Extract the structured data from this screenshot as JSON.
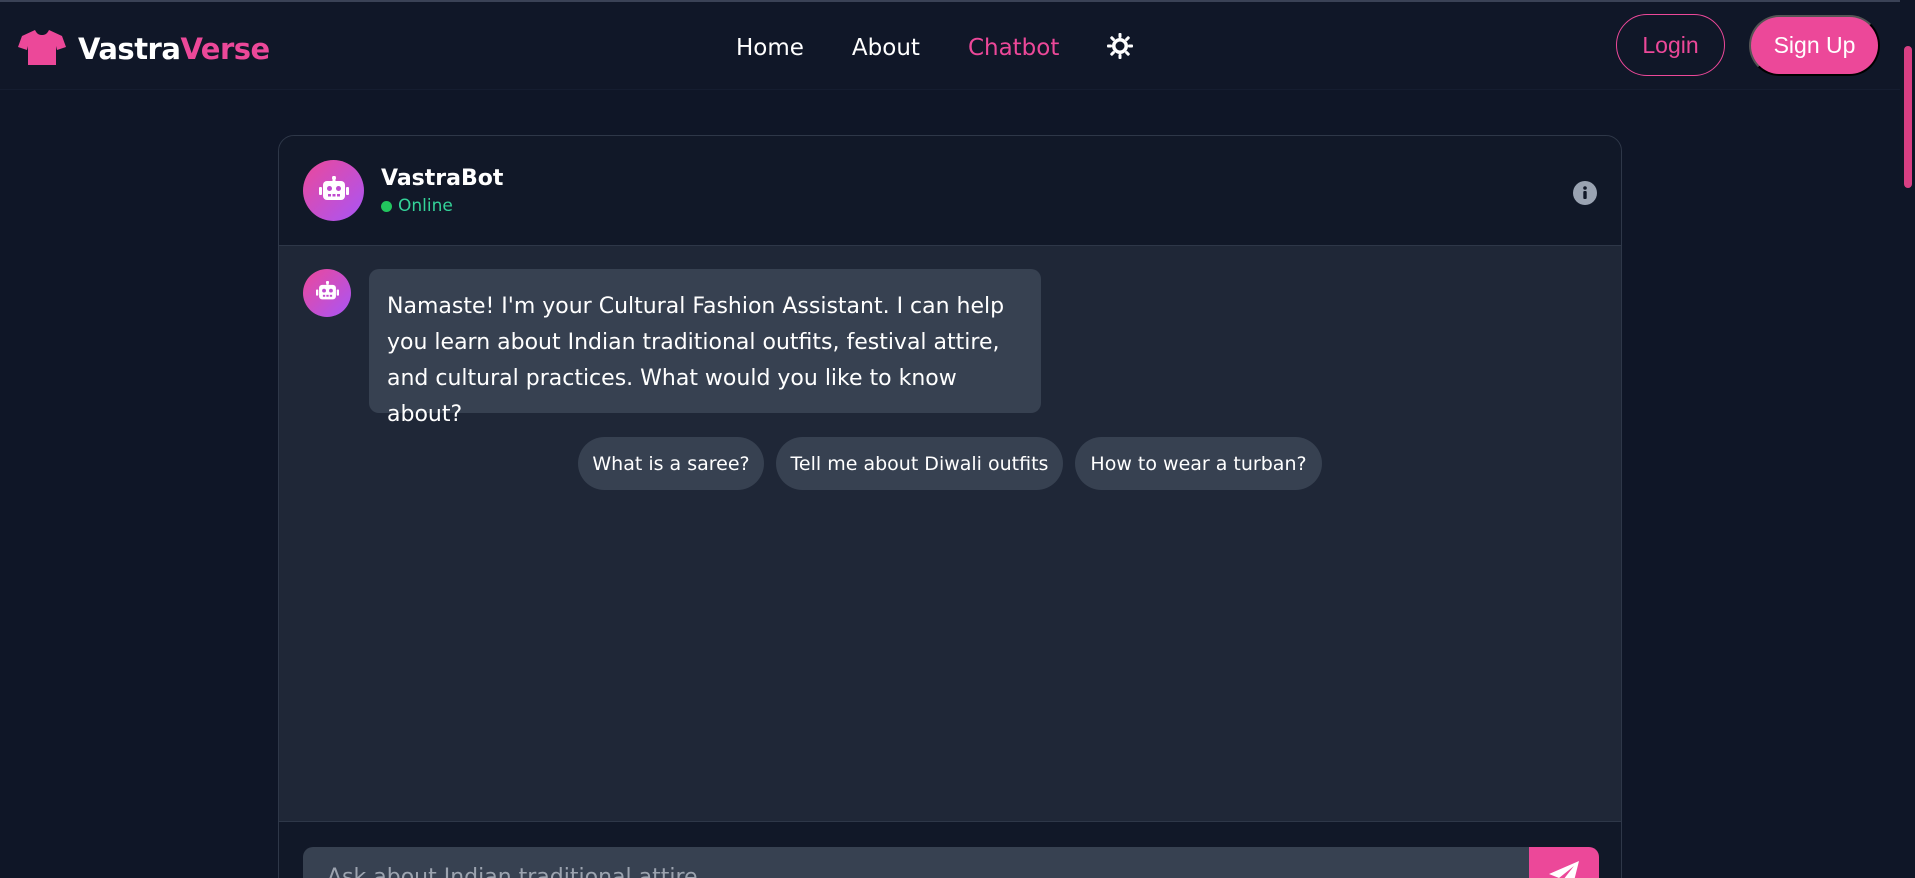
{
  "brand": {
    "name_part1": "Vastra",
    "name_part2": "Verse",
    "logo_icon": "tshirt-icon"
  },
  "nav": {
    "links": [
      {
        "label": "Home"
      },
      {
        "label": "About"
      },
      {
        "label": "Chatbot",
        "active": true
      }
    ],
    "theme_toggle_icon": "sun-icon"
  },
  "auth": {
    "login_label": "Login",
    "signup_label": "Sign Up"
  },
  "chat": {
    "bot_name": "VastraBot",
    "status": "Online",
    "bot_icon": "robot-icon",
    "info_icon": "info-icon",
    "messages": [
      {
        "from": "bot",
        "text": "Namaste! I'm your Cultural Fashion Assistant. I can help you learn about Indian traditional outfits, festival attire, and cultural practices. What would you like to know about?"
      }
    ],
    "suggestions": [
      "What is a saree?",
      "Tell me about Diwali outfits",
      "How to wear a turban?"
    ],
    "input": {
      "placeholder": "Ask about Indian traditional attire...",
      "value": ""
    },
    "send_icon": "paper-plane-icon"
  },
  "colors": {
    "accent": "#ec4899",
    "background": "#0f1627",
    "navbar": "#101728",
    "card": "#1f2737",
    "bubble": "#374151",
    "online": "#22c55e"
  }
}
